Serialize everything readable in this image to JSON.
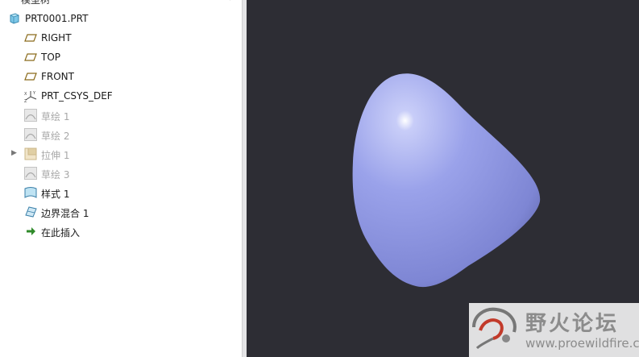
{
  "panel": {
    "title": "模型树"
  },
  "tree": {
    "root": {
      "label": "PRT0001.PRT",
      "icon": "part-icon"
    },
    "items": [
      {
        "label": "RIGHT",
        "icon": "datum-plane-icon",
        "dim": false
      },
      {
        "label": "TOP",
        "icon": "datum-plane-icon",
        "dim": false
      },
      {
        "label": "FRONT",
        "icon": "datum-plane-icon",
        "dim": false
      },
      {
        "label": "PRT_CSYS_DEF",
        "icon": "csys-icon",
        "dim": false
      },
      {
        "label": "草绘 1",
        "icon": "sketch-icon",
        "dim": true
      },
      {
        "label": "草绘 2",
        "icon": "sketch-icon",
        "dim": true
      },
      {
        "label": "拉伸 1",
        "icon": "extrude-icon",
        "dim": true,
        "expandable": true
      },
      {
        "label": "草绘 3",
        "icon": "sketch-icon",
        "dim": true
      },
      {
        "label": "样式 1",
        "icon": "style-surface-icon",
        "dim": false
      },
      {
        "label": "边界混合 1",
        "icon": "boundary-blend-icon",
        "dim": false
      },
      {
        "label": "在此插入",
        "icon": "insert-arrow-icon",
        "dim": false
      }
    ]
  },
  "viewport": {
    "background": "#2d2d34",
    "model_color": "#8b93e0"
  },
  "watermark": {
    "title": "野火论坛",
    "url": "www.proewildfire.cn"
  }
}
